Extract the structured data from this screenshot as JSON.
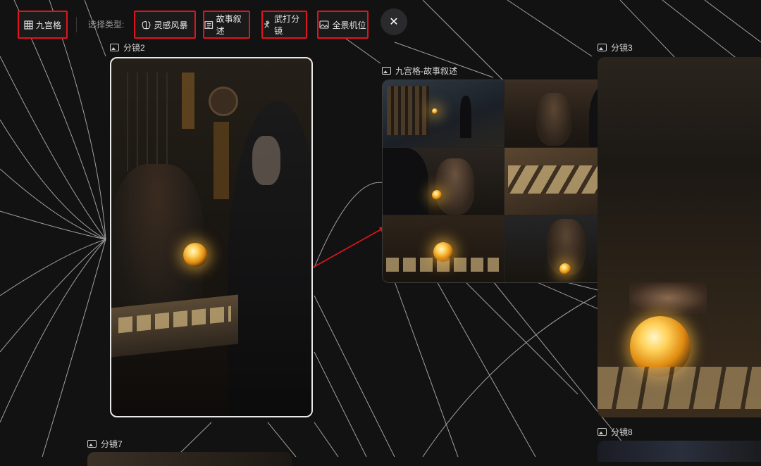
{
  "toolbar": {
    "grid_label": "九宫格",
    "select_type_label": "选择类型:",
    "brainstorm_label": "灵感风暴",
    "story_label": "故事叙述",
    "martial_label": "武打分镜",
    "panorama_label": "全景机位"
  },
  "cards": {
    "shot2_title": "分镜2",
    "grid_story_title": "九宫格-故事叙述",
    "shot3_title": "分镜3",
    "shot7_title": "分镜7",
    "shot8_title": "分镜8"
  },
  "colors": {
    "background": "#121213",
    "highlight_border": "#e0141d",
    "connector_arrow": "#e0141d",
    "web_lines": "#bdbdbd"
  }
}
